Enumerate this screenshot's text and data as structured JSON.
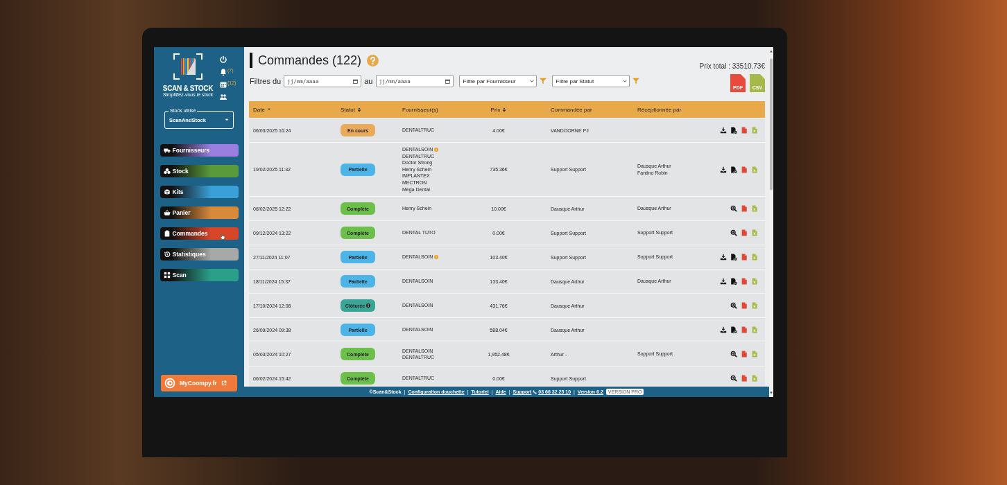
{
  "sidebar": {
    "brand": "SCAN & STOCK",
    "tagline": "Simplifiez-vous le stock",
    "top_icons": [
      {
        "kind": "power"
      },
      {
        "kind": "bell",
        "badge": "(7)"
      },
      {
        "kind": "calendar",
        "badge": "(12)"
      },
      {
        "kind": "users"
      }
    ],
    "stock_select": {
      "legend": "Stock utilisé",
      "value": "ScanAndStock"
    },
    "nav": [
      {
        "label": "Fournisseurs",
        "kind": "truck",
        "color": "#9a7ee0",
        "hovered": false
      },
      {
        "label": "Stock",
        "kind": "boxes",
        "color": "#5a9a3a",
        "hovered": false
      },
      {
        "label": "Kits",
        "kind": "kit",
        "color": "#3aa0d8",
        "hovered": false
      },
      {
        "label": "Panier",
        "kind": "basket",
        "color": "#d88a3a",
        "hovered": false
      },
      {
        "label": "Commandes",
        "kind": "clipboard",
        "color": "#d8462a",
        "hovered": true
      },
      {
        "label": "Statistiques",
        "kind": "history",
        "color": "#a8a8a8",
        "hovered": false
      },
      {
        "label": "Scan",
        "kind": "grid",
        "color": "#2aa08a",
        "hovered": false
      }
    ],
    "partner_button": {
      "label": "MyCoompy.fr"
    }
  },
  "header": {
    "title": "Commandes (122)",
    "filters_label": "Filtres du",
    "to_label": "au",
    "date_from": {
      "placeholder": "jj/mm/aaaa"
    },
    "date_to": {
      "placeholder": "jj/mm/aaaa"
    },
    "supplier_filter": "Filtre par Fournisseur",
    "status_filter": "Filtre par Statut",
    "total": "Prix total : 33510.73€",
    "exports": [
      {
        "label": "PDF",
        "kind": "pdf"
      },
      {
        "label": "CSV",
        "kind": "csv"
      }
    ]
  },
  "table": {
    "columns": [
      {
        "label": "Date",
        "kind": "sortdesc"
      },
      {
        "label": "Statut",
        "kind": "sortable"
      },
      {
        "label": "Fournisseur(s)",
        "kind": "plain"
      },
      {
        "label": "Prix",
        "kind": "sortable"
      },
      {
        "label": "Commandée par",
        "kind": "plain"
      },
      {
        "label": "Réceptionnée par",
        "kind": "plain"
      }
    ],
    "rows": [
      {
        "date": "06/03/2025 16:24",
        "status": {
          "label": "En cours",
          "kind": "en_cours",
          "info": false
        },
        "suppliers": [
          {
            "name": "DENTALTRUC",
            "alert": false
          }
        ],
        "price": "4.00€",
        "ordered_by": "VANDOORNE PJ",
        "received_by": [],
        "actions": [
          {
            "kind": "download"
          },
          {
            "kind": "cancel"
          },
          {
            "kind": "pdf"
          },
          {
            "kind": "excel"
          }
        ]
      },
      {
        "date": "19/02/2025 11:32",
        "status": {
          "label": "Partielle",
          "kind": "partielle",
          "info": false
        },
        "suppliers": [
          {
            "name": "DENTALSOIN",
            "alert": true
          },
          {
            "name": "DENTALTRUC",
            "alert": false
          },
          {
            "name": "Doctor Strong",
            "alert": false
          },
          {
            "name": "Henry Schein",
            "alert": false
          },
          {
            "name": "IMPLANTEX",
            "alert": false
          },
          {
            "name": "MECTRON",
            "alert": false
          },
          {
            "name": "Mega Dental",
            "alert": false
          }
        ],
        "price": "735.36€",
        "ordered_by": "Support Support",
        "received_by": [
          "Dausque Arthur",
          "Fantino Robin"
        ],
        "actions": [
          {
            "kind": "download"
          },
          {
            "kind": "cancel"
          },
          {
            "kind": "pdf"
          },
          {
            "kind": "excel"
          }
        ]
      },
      {
        "date": "06/02/2025 12:22",
        "status": {
          "label": "Complète",
          "kind": "complete",
          "info": false
        },
        "suppliers": [
          {
            "name": "Henry Schein",
            "alert": false
          }
        ],
        "price": "10.00€",
        "ordered_by": "Dausque Arthur",
        "received_by": [
          "Dausque Arthur"
        ],
        "actions": [
          {
            "kind": "zoom"
          },
          {
            "kind": "pdf"
          },
          {
            "kind": "excel"
          }
        ]
      },
      {
        "date": "09/12/2024 13:22",
        "status": {
          "label": "Complète",
          "kind": "complete",
          "info": false
        },
        "suppliers": [
          {
            "name": "DENTAL TUTO",
            "alert": false
          }
        ],
        "price": "0.00€",
        "ordered_by": "Support Support",
        "received_by": [
          "Support Support"
        ],
        "actions": [
          {
            "kind": "zoom"
          },
          {
            "kind": "pdf"
          },
          {
            "kind": "excel"
          }
        ]
      },
      {
        "date": "27/11/2024 11:07",
        "status": {
          "label": "Partielle",
          "kind": "partielle",
          "info": false
        },
        "suppliers": [
          {
            "name": "DENTALSOIN",
            "alert": true
          }
        ],
        "price": "103.40€",
        "ordered_by": "Support Support",
        "received_by": [
          "Support Support"
        ],
        "actions": [
          {
            "kind": "download"
          },
          {
            "kind": "cancel"
          },
          {
            "kind": "pdf"
          },
          {
            "kind": "excel"
          }
        ]
      },
      {
        "date": "18/11/2024 15:37",
        "status": {
          "label": "Partielle",
          "kind": "partielle",
          "info": false
        },
        "suppliers": [
          {
            "name": "DENTALSOIN",
            "alert": false
          }
        ],
        "price": "133.40€",
        "ordered_by": "Dausque Arthur",
        "received_by": [
          "Dausque Arthur"
        ],
        "actions": [
          {
            "kind": "download"
          },
          {
            "kind": "cancel"
          },
          {
            "kind": "pdf"
          },
          {
            "kind": "excel"
          }
        ]
      },
      {
        "date": "17/10/2024 12:08",
        "status": {
          "label": "Clôturée",
          "kind": "cloturee",
          "info": true
        },
        "suppliers": [
          {
            "name": "DENTALSOIN",
            "alert": false
          }
        ],
        "price": "431.76€",
        "ordered_by": "Dausque Arthur",
        "received_by": [],
        "actions": [
          {
            "kind": "zoom"
          },
          {
            "kind": "pdf"
          },
          {
            "kind": "excel"
          }
        ]
      },
      {
        "date": "26/09/2024 09:38",
        "status": {
          "label": "Partielle",
          "kind": "partielle",
          "info": false
        },
        "suppliers": [
          {
            "name": "DENTALSOIN",
            "alert": false
          }
        ],
        "price": "588.04€",
        "ordered_by": "Dausque Arthur",
        "received_by": [],
        "actions": [
          {
            "kind": "download"
          },
          {
            "kind": "cancel"
          },
          {
            "kind": "pdf"
          },
          {
            "kind": "excel"
          }
        ]
      },
      {
        "date": "05/03/2024 10:27",
        "status": {
          "label": "Complète",
          "kind": "complete",
          "info": false
        },
        "suppliers": [
          {
            "name": "DENTALSOIN",
            "alert": false
          },
          {
            "name": "DENTALTRUC",
            "alert": false
          }
        ],
        "price": "1,952.48€",
        "ordered_by": "Arthur -",
        "received_by": [
          "Support Support"
        ],
        "actions": [
          {
            "kind": "zoom"
          },
          {
            "kind": "pdf"
          },
          {
            "kind": "excel"
          }
        ]
      },
      {
        "date": "06/02/2024 15:42",
        "status": {
          "label": "Complète",
          "kind": "complete",
          "info": false
        },
        "suppliers": [
          {
            "name": "DENTALTRUC",
            "alert": false
          }
        ],
        "price": "0.00€",
        "ordered_by": "Support Support",
        "received_by": [],
        "actions": [
          {
            "kind": "zoom"
          },
          {
            "kind": "pdf"
          },
          {
            "kind": "excel"
          }
        ]
      }
    ]
  },
  "footer": {
    "copyright": "©Scan&Stock",
    "separator": "|",
    "links": [
      {
        "label": "Configuration douchette",
        "kind": "plain"
      },
      {
        "label": "Tutoriel",
        "kind": "plain"
      },
      {
        "label": "Aide",
        "kind": "plain"
      },
      {
        "label": "Support",
        "kind": "phone",
        "extra": "03 66 32 25 10"
      },
      {
        "label": "Version 6.2",
        "kind": "plain"
      }
    ],
    "badge": "VERSION PRO"
  }
}
